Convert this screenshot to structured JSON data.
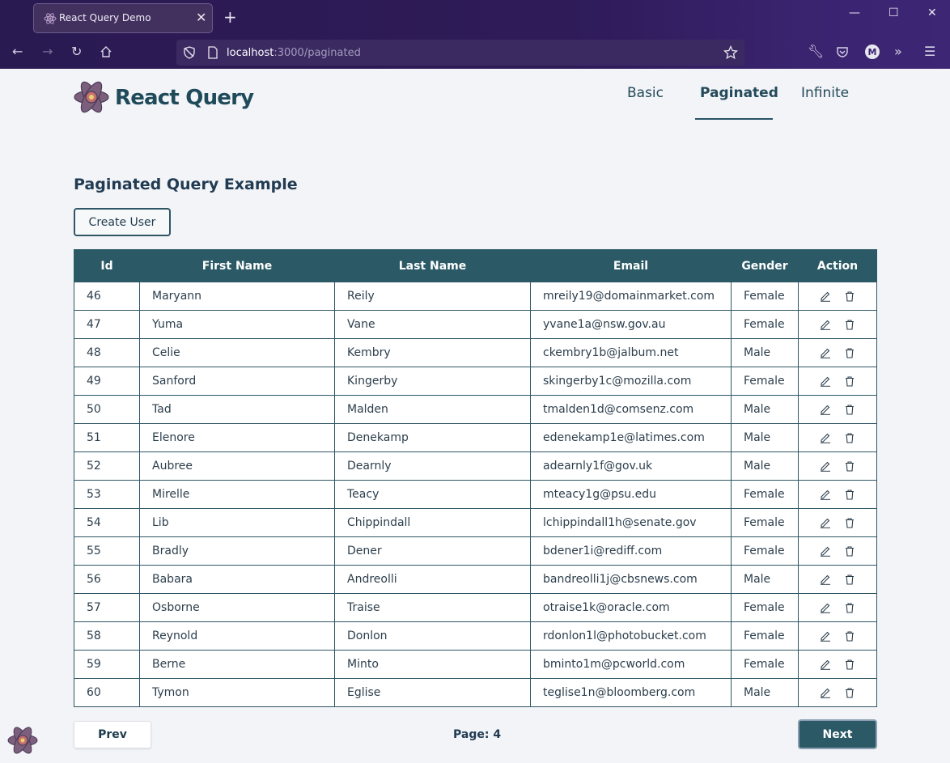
{
  "browser": {
    "tab_title": "React Query Demo",
    "url_host": "localhost",
    "url_rest": ":3000/paginated"
  },
  "brand": {
    "name": "React Query",
    "accent": "#2b5a66"
  },
  "nav": {
    "items": [
      {
        "label": "Basic"
      },
      {
        "label": "Paginated"
      },
      {
        "label": "Infinite"
      }
    ],
    "active": "Paginated"
  },
  "page": {
    "heading": "Paginated Query Example",
    "create_button": "Create User"
  },
  "table": {
    "columns": [
      "Id",
      "First Name",
      "Last Name",
      "Email",
      "Gender",
      "Action"
    ],
    "rows": [
      [
        "46",
        "Maryann",
        "Reily",
        "mreily19@domainmarket.com",
        "Female"
      ],
      [
        "47",
        "Yuma",
        "Vane",
        "yvane1a@nsw.gov.au",
        "Female"
      ],
      [
        "48",
        "Celie",
        "Kembry",
        "ckembry1b@jalbum.net",
        "Male"
      ],
      [
        "49",
        "Sanford",
        "Kingerby",
        "skingerby1c@mozilla.com",
        "Female"
      ],
      [
        "50",
        "Tad",
        "Malden",
        "tmalden1d@comsenz.com",
        "Male"
      ],
      [
        "51",
        "Elenore",
        "Denekamp",
        "edenekamp1e@latimes.com",
        "Male"
      ],
      [
        "52",
        "Aubree",
        "Dearnly",
        "adearnly1f@gov.uk",
        "Male"
      ],
      [
        "53",
        "Mirelle",
        "Teacy",
        "mteacy1g@psu.edu",
        "Female"
      ],
      [
        "54",
        "Lib",
        "Chippindall",
        "lchippindall1h@senate.gov",
        "Female"
      ],
      [
        "55",
        "Bradly",
        "Dener",
        "bdener1i@rediff.com",
        "Female"
      ],
      [
        "56",
        "Babara",
        "Andreolli",
        "bandreolli1j@cbsnews.com",
        "Male"
      ],
      [
        "57",
        "Osborne",
        "Traise",
        "otraise1k@oracle.com",
        "Female"
      ],
      [
        "58",
        "Reynold",
        "Donlon",
        "rdonlon1l@photobucket.com",
        "Female"
      ],
      [
        "59",
        "Berne",
        "Minto",
        "bminto1m@pcworld.com",
        "Female"
      ],
      [
        "60",
        "Tymon",
        "Eglise",
        "teglise1n@bloomberg.com",
        "Male"
      ]
    ],
    "action_icons": [
      "edit-icon",
      "trash-icon"
    ]
  },
  "pagination": {
    "prev_label": "Prev",
    "next_label": "Next",
    "page_text": "Page: 4"
  }
}
